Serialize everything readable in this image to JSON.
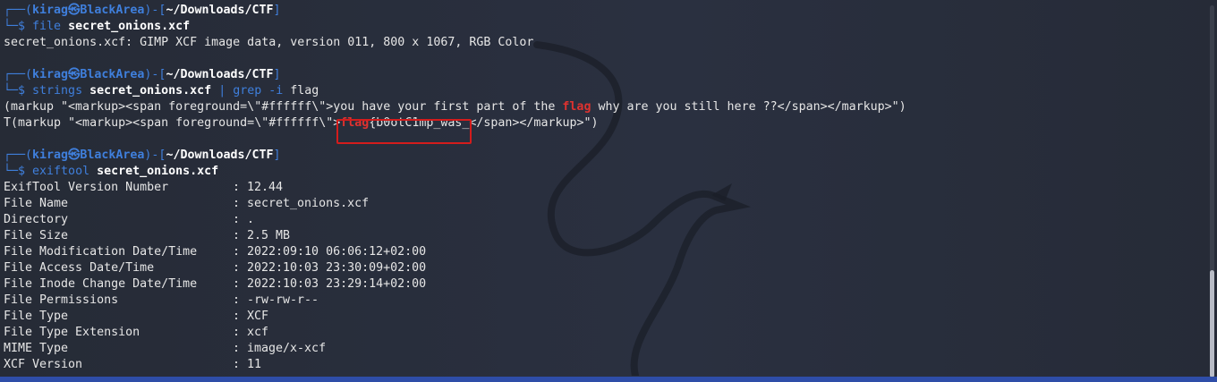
{
  "prompt": {
    "top_prefix": "┌──(",
    "user": "kirag",
    "at": "㉿",
    "host": "BlackArea",
    "sep": ")-[",
    "path": "~/Downloads/CTF",
    "close": "]",
    "bottom_prefix": "└─",
    "dollar": "$ "
  },
  "blocks": [
    {
      "cmd": "file",
      "args": [
        {
          "text": " secret_onions.xcf",
          "style": "bold"
        }
      ],
      "output": [
        "secret_onions.xcf: GIMP XCF image data, version 011, 800 x 1067, RGB Color"
      ]
    },
    {
      "cmd": "strings",
      "args": [
        {
          "text": " secret_onions.xcf",
          "style": "bold"
        },
        {
          "text": " |",
          "style": "pipe"
        },
        {
          "text": " grep",
          "style": "pipe"
        },
        {
          "text": " -i",
          "style": "pipe"
        },
        {
          "text": " flag",
          "style": "plain"
        }
      ],
      "output_rich": [
        [
          {
            "text": "(markup \"<markup><span foreground=\\\"#ffffff\\\">you have your first part of the ",
            "style": "plain"
          },
          {
            "text": "flag",
            "style": "flag"
          },
          {
            "text": " why are you still here ??</span></markup>\")",
            "style": "plain"
          }
        ],
        [
          {
            "text": "T(markup \"<markup><span foreground=\\\"#ffffff\\\">",
            "style": "plain"
          },
          {
            "text": "flag",
            "style": "flag"
          },
          {
            "text": "{b0otC1mp_was_<",
            "style": "plain"
          },
          {
            "text": "/span></markup>\")",
            "style": "plain"
          }
        ]
      ]
    },
    {
      "cmd": "exiftool",
      "args": [
        {
          "text": " secret_onions.xcf",
          "style": "bold"
        }
      ],
      "kv": [
        [
          "ExifTool Version Number",
          ": 12.44"
        ],
        [
          "File Name",
          ": secret_onions.xcf"
        ],
        [
          "Directory",
          ": ."
        ],
        [
          "File Size",
          ": 2.5 MB"
        ],
        [
          "File Modification Date/Time",
          ": 2022:09:10 06:06:12+02:00"
        ],
        [
          "File Access Date/Time",
          ": 2022:10:03 23:30:09+02:00"
        ],
        [
          "File Inode Change Date/Time",
          ": 2022:10:03 23:29:14+02:00"
        ],
        [
          "File Permissions",
          ": -rw-rw-r--"
        ],
        [
          "File Type",
          ": XCF"
        ],
        [
          "File Type Extension",
          ": xcf"
        ],
        [
          "MIME Type",
          ": image/x-xcf"
        ],
        [
          "XCF Version",
          ": 11"
        ]
      ]
    }
  ],
  "colors": {
    "background": "#262b36",
    "prompt_blue": "#3f7fdc",
    "flag_red": "#e0322f",
    "annotation_red": "#d41c1c",
    "text": "#e6e6e6"
  },
  "icons": {
    "background_logo": "kali-dragon-icon"
  }
}
